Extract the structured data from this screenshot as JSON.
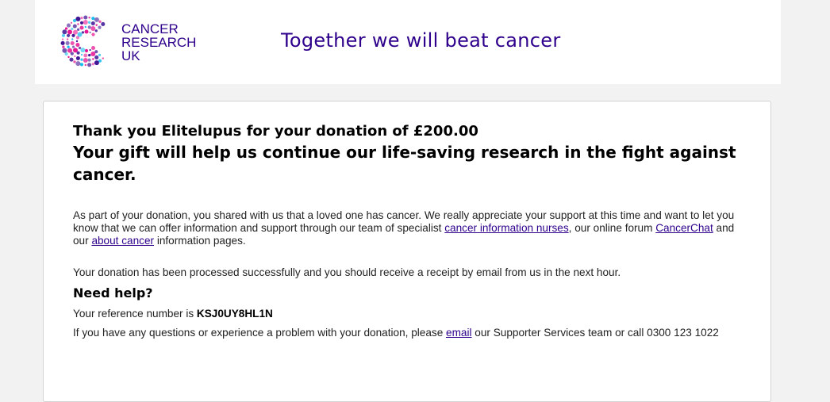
{
  "header": {
    "logo_lines": [
      "CANCER",
      "RESEARCH",
      "UK"
    ],
    "tagline": "Together we will beat cancer"
  },
  "main": {
    "thanks_heading": "Thank you Elitelupus for your donation of £200.00",
    "gift_heading": "Your gift will help us continue our life-saving research in the fight against cancer.",
    "para1": {
      "text_a": "As part of your donation, you shared with us that a loved one has cancer. We really appreciate your support at this time and want to let you know that we can offer information and support through our team of specialist ",
      "link_nurses": "cancer information nurses",
      "text_b": ", our online forum ",
      "link_cancerchat": "CancerChat",
      "text_c": " and our ",
      "link_about": "about cancer",
      "text_d": " information pages."
    },
    "para2": "Your donation has been processed successfully and you should receive a receipt by email from us in the next hour.",
    "help_heading": "Need help?",
    "reference_label": "Your reference number is ",
    "reference_number": "KSJ0UY8HL1N",
    "contact": {
      "text_a": "If you have any questions or experience a problem with your donation, please ",
      "link_email": "email",
      "text_b": " our Supporter Services team or call 0300 123 1022"
    }
  },
  "colors": {
    "brand_purple": "#2e008b",
    "logo_pink": "#e40089",
    "logo_blue": "#00b6ed",
    "logo_purple": "#2e008b"
  }
}
